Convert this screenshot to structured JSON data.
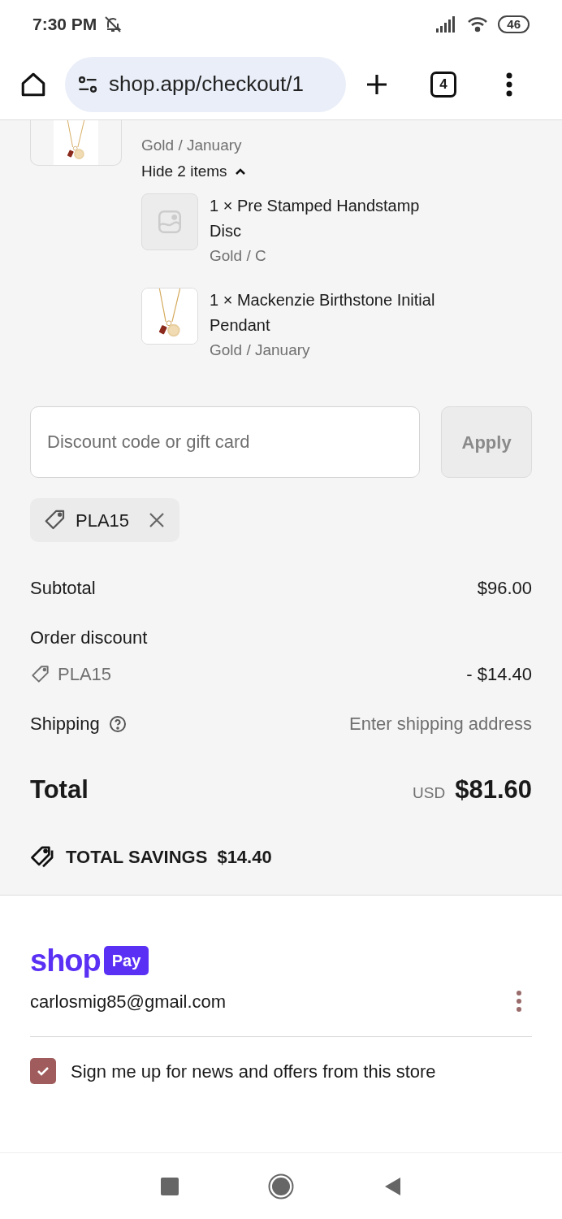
{
  "status_bar": {
    "time": "7:30 PM",
    "battery": "46"
  },
  "browser": {
    "url": "shop.app/checkout/1",
    "tab_count": "4"
  },
  "order": {
    "main_item": {
      "variant": "Gold / January"
    },
    "toggle": {
      "label": "Hide 2 items",
      "expanded": true
    },
    "bundle_items": [
      {
        "kind": "placeholder",
        "title": "1 × Pre Stamped Handstamp Disc",
        "variant": "Gold / C"
      },
      {
        "kind": "picture",
        "title": "1 × Mackenzie Birthstone Initial Pendant",
        "variant": "Gold / January"
      }
    ]
  },
  "discount": {
    "placeholder": "Discount code or gift card",
    "apply": "Apply",
    "applied_code": "PLA15"
  },
  "summary": {
    "subtotal_label": "Subtotal",
    "subtotal": "$96.00",
    "discount_label": "Order discount",
    "discount_code": "PLA15",
    "discount_amount": "- $14.40",
    "shipping_label": "Shipping",
    "shipping_value": "Enter shipping address",
    "total_label": "Total",
    "currency": "USD",
    "total": "$81.60",
    "savings_label": "TOTAL SAVINGS",
    "savings": "$14.40"
  },
  "shop_pay": {
    "wordmark": "shop",
    "badge": "Pay",
    "email": "carlosmig85@gmail.com",
    "newsletter": {
      "label": "Sign me up for news and offers from this store",
      "checked": true
    }
  }
}
